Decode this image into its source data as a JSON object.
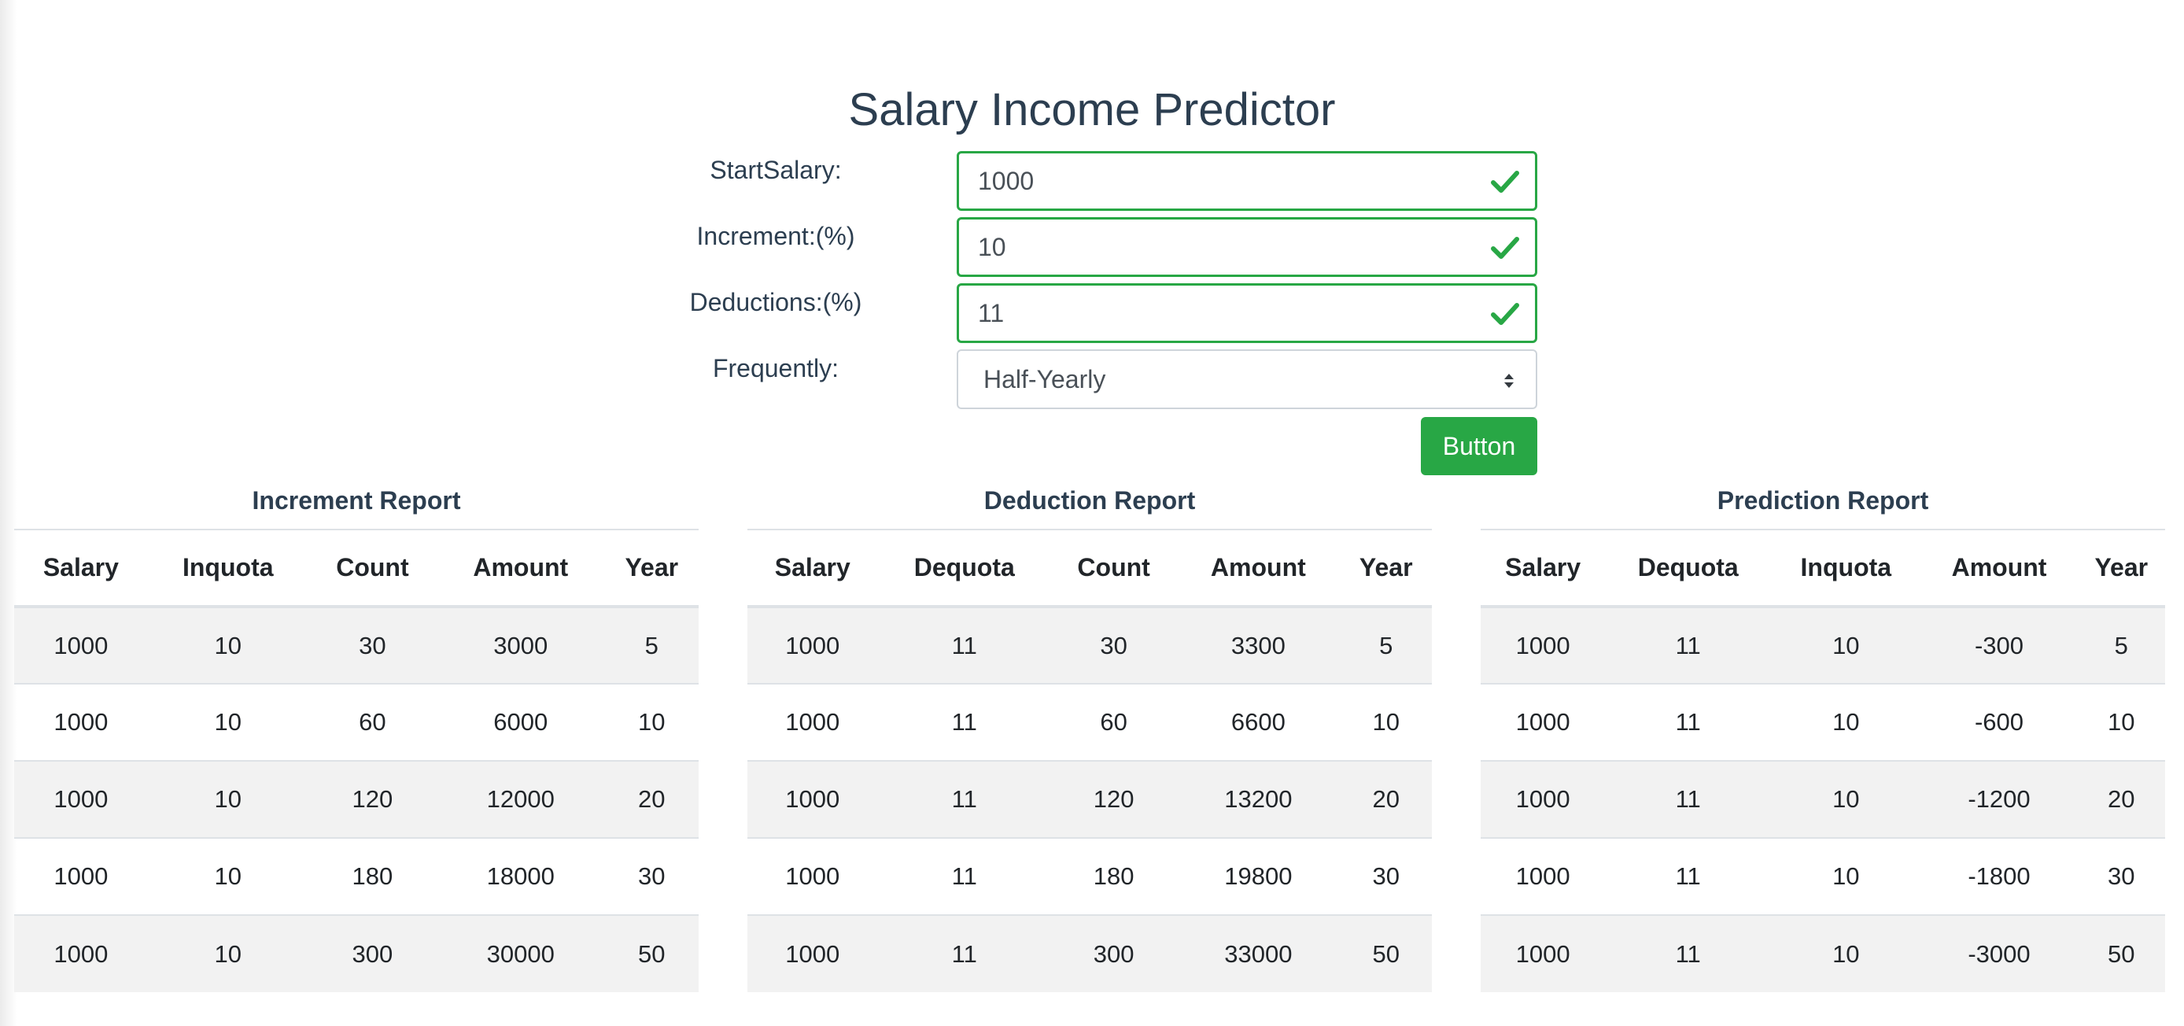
{
  "app": {
    "title": "Salary Income Predictor"
  },
  "form": {
    "start_salary": {
      "label": "StartSalary:",
      "value": "1000"
    },
    "increment": {
      "label": "Increment:(%)",
      "value": "10"
    },
    "deductions": {
      "label": "Deductions:(%)",
      "value": "11"
    },
    "frequently": {
      "label": "Frequently:",
      "value": "Half-Yearly"
    },
    "button_label": "Button"
  },
  "colors": {
    "valid": "#28a745",
    "text": "#2c3e50",
    "stripe": "#f2f2f2"
  },
  "reports": {
    "increment": {
      "title": "Increment Report",
      "headers": [
        "Salary",
        "Inquota",
        "Count",
        "Amount",
        "Year"
      ],
      "rows": [
        [
          "1000",
          "10",
          "30",
          "3000",
          "5"
        ],
        [
          "1000",
          "10",
          "60",
          "6000",
          "10"
        ],
        [
          "1000",
          "10",
          "120",
          "12000",
          "20"
        ],
        [
          "1000",
          "10",
          "180",
          "18000",
          "30"
        ],
        [
          "1000",
          "10",
          "300",
          "30000",
          "50"
        ]
      ]
    },
    "deduction": {
      "title": "Deduction Report",
      "headers": [
        "Salary",
        "Dequota",
        "Count",
        "Amount",
        "Year"
      ],
      "rows": [
        [
          "1000",
          "11",
          "30",
          "3300",
          "5"
        ],
        [
          "1000",
          "11",
          "60",
          "6600",
          "10"
        ],
        [
          "1000",
          "11",
          "120",
          "13200",
          "20"
        ],
        [
          "1000",
          "11",
          "180",
          "19800",
          "30"
        ],
        [
          "1000",
          "11",
          "300",
          "33000",
          "50"
        ]
      ]
    },
    "prediction": {
      "title": "Prediction Report",
      "headers": [
        "Salary",
        "Dequota",
        "Inquota",
        "Amount",
        "Year"
      ],
      "rows": [
        [
          "1000",
          "11",
          "10",
          "-300",
          "5"
        ],
        [
          "1000",
          "11",
          "10",
          "-600",
          "10"
        ],
        [
          "1000",
          "11",
          "10",
          "-1200",
          "20"
        ],
        [
          "1000",
          "11",
          "10",
          "-1800",
          "30"
        ],
        [
          "1000",
          "11",
          "10",
          "-3000",
          "50"
        ]
      ]
    }
  }
}
